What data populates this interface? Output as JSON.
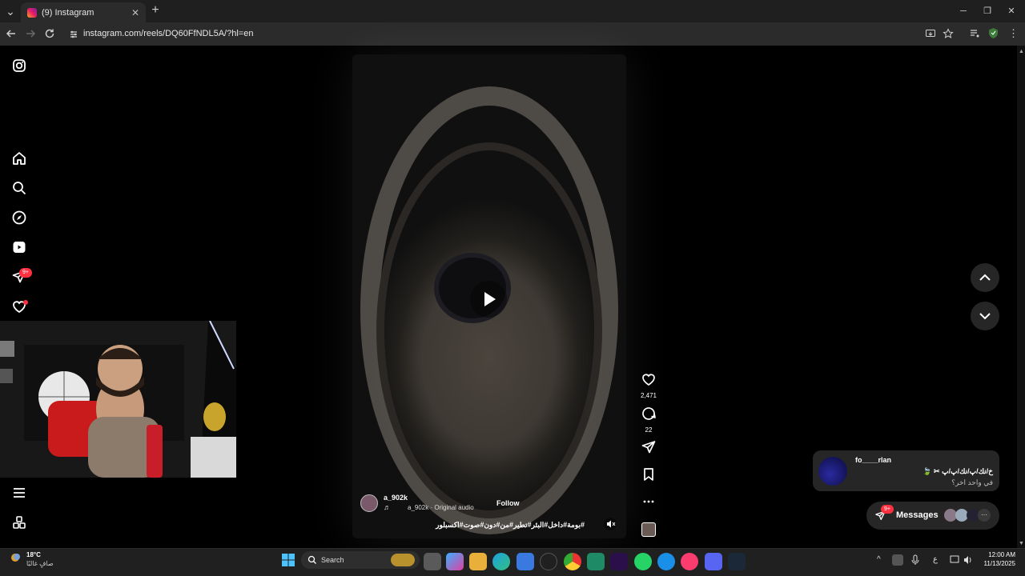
{
  "browser": {
    "tab_title": "(9) Instagram",
    "url": "instagram.com/reels/DQ60FfNDL5A/?hl=en",
    "new_tab": "+",
    "tab_close": "✕",
    "win_minimize": "─",
    "win_restore": "❐",
    "win_close": "✕"
  },
  "sidebar": {
    "icons": [
      "instagram-icon",
      "home-icon",
      "search-icon",
      "explore-icon",
      "reels-icon",
      "messages-icon",
      "notifications-icon",
      "menu-icon",
      "more-icon"
    ],
    "messages_badge": "9+"
  },
  "reel": {
    "username": "a_902k",
    "audio": "a_902k · Original audio",
    "follow_label": "Follow",
    "caption": "#بومة#داخل#البئر#تطير#من#دون#صوت#اكسبلور",
    "likes": "2,471",
    "comments": "22"
  },
  "notification": {
    "sender": "fo____rlan",
    "line1": "خ/نك/پ/نك/پ/پ ✂ 🍃",
    "line2": "في واحد اخر؟"
  },
  "messages_pill": {
    "label": "Messages",
    "badge": "9+",
    "more": "···"
  },
  "taskbar": {
    "temp": "18°C",
    "weather": "صافٍ غالبًا",
    "search_label": "Search",
    "time": "12:00 AM",
    "date": "11/13/2025",
    "lang": "ع"
  },
  "colors": {
    "badge": "#ff3040",
    "follow": "#ffffff",
    "panel": "#262626"
  }
}
